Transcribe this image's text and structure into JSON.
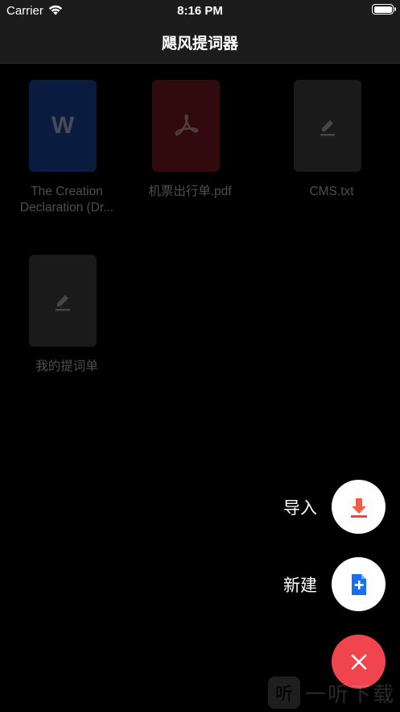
{
  "status": {
    "carrier": "Carrier",
    "time": "8:16 PM"
  },
  "nav": {
    "title": "飓风提词器"
  },
  "documents": [
    {
      "label": "The Creation Declaration (Dr...",
      "type": "word",
      "color": "#1b4fb3"
    },
    {
      "label": "机票出行单.pdf",
      "type": "pdf",
      "color": "#8a1e24"
    },
    {
      "label": "CMS.txt",
      "type": "text",
      "color": "#4a4a4a"
    },
    {
      "label": "我的提词单",
      "type": "text",
      "color": "#4a4a4a"
    }
  ],
  "actions": {
    "import_label": "导入",
    "new_label": "新建"
  },
  "watermark": {
    "glyph": "听",
    "text": "一听下载"
  }
}
